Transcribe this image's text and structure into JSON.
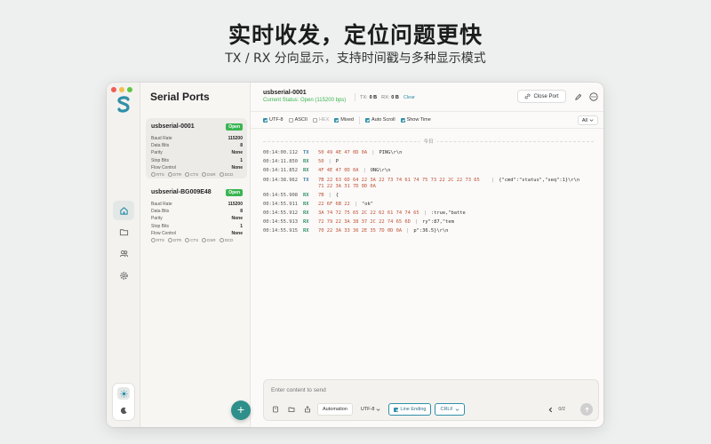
{
  "hero": {
    "title": "实时收发，定位问题更快",
    "subtitle": "TX / RX 分向显示，支持时间戳与多种显示模式"
  },
  "colors": {
    "accent": "#2f8fa8",
    "open_badge": "#3ab552",
    "tx": "#3b7fa8",
    "rx": "#2f8f6a",
    "hex": "#c0513a"
  },
  "sidebar": {
    "icons": [
      "home-icon",
      "folder-icon",
      "users-icon",
      "gear-icon"
    ],
    "theme_icons": [
      "sun-icon",
      "moon-icon"
    ]
  },
  "ports": {
    "title": "Serial Ports",
    "items": [
      {
        "name": "usbserial-0001",
        "status": "Open",
        "rows": [
          {
            "label": "Baud Rate",
            "value": "115200"
          },
          {
            "label": "Data Bits",
            "value": "8"
          },
          {
            "label": "Parity",
            "value": "None"
          },
          {
            "label": "Stop Bits",
            "value": "1"
          },
          {
            "label": "Flow Control",
            "value": "None"
          }
        ],
        "signals": [
          "RTS",
          "DTR",
          "CTS",
          "DSR",
          "DCD"
        ]
      },
      {
        "name": "usbserial-BG009E48",
        "status": "Open",
        "rows": [
          {
            "label": "Baud Rate",
            "value": "115200"
          },
          {
            "label": "Data Bits",
            "value": "8"
          },
          {
            "label": "Parity",
            "value": "None"
          },
          {
            "label": "Stop Bits",
            "value": "1"
          },
          {
            "label": "Flow Control",
            "value": "None"
          }
        ],
        "signals": [
          "RTS",
          "DTR",
          "CTS",
          "DSR",
          "DCD"
        ]
      }
    ],
    "add_label": "+"
  },
  "main": {
    "port_name": "usbserial-0001",
    "status": "Current Status: Open (115200 bps)",
    "tx_label": "TX:",
    "tx_value": "0 B",
    "rx_label": "RX:",
    "rx_value": "0 B",
    "clear_label": "Clear",
    "close_port_label": "Close Port",
    "toolbar": {
      "utf8": "UTF-8",
      "ascii": "ASCII",
      "hex": "HEX",
      "mixed": "Mixed",
      "auto_scroll": "Auto Scroll",
      "show_time": "Show Time",
      "direction": "All"
    },
    "day": "今日",
    "log": [
      {
        "ts": "00:14:00.112",
        "dir": "TX",
        "hex": "50 49 4E 47 0D 0A",
        "ascii": "PING\\r\\n"
      },
      {
        "ts": "00:14:11.850",
        "dir": "RX",
        "hex": "50",
        "ascii": "P"
      },
      {
        "ts": "00:14:11.852",
        "dir": "RX",
        "hex": "4F 4E 47 0D 0A",
        "ascii": "ONG\\r\\n"
      },
      {
        "ts": "00:14:38.962",
        "dir": "TX",
        "hex": "7B 22 63 6D 64 22 3A 22 73 74 61 74 75 73 22 2C 22 73 65 71 22 3A 31 7D 0D 0A",
        "ascii": "{\"cmd\":\"status\",\"seq\":1}\\r\\n"
      },
      {
        "ts": "00:14:55.908",
        "dir": "RX",
        "hex": "7B",
        "ascii": "{"
      },
      {
        "ts": "00:14:55.911",
        "dir": "RX",
        "hex": "22 6F 6B 22",
        "ascii": "\"ok\""
      },
      {
        "ts": "00:14:55.912",
        "dir": "RX",
        "hex": "3A 74 72 75 65 2C 22 62 61 74 74 65",
        "ascii": ":true,\"batte"
      },
      {
        "ts": "00:14:55.913",
        "dir": "RX",
        "hex": "72 79 22 3A 38 37 2C 22 74 65 6D",
        "ascii": "ry\":87,\"tem"
      },
      {
        "ts": "00:14:55.915",
        "dir": "RX",
        "hex": "70 22 3A 33 36 2E 35 7D 0D 0A",
        "ascii": "p\":36.5}\\r\\n"
      }
    ],
    "composer": {
      "placeholder": "Enter content to send",
      "automation": "Automation",
      "encoding": "UTF-8",
      "line_ending": "Line Ending",
      "line_ending_value": "CRLF",
      "page": "0/2"
    }
  }
}
